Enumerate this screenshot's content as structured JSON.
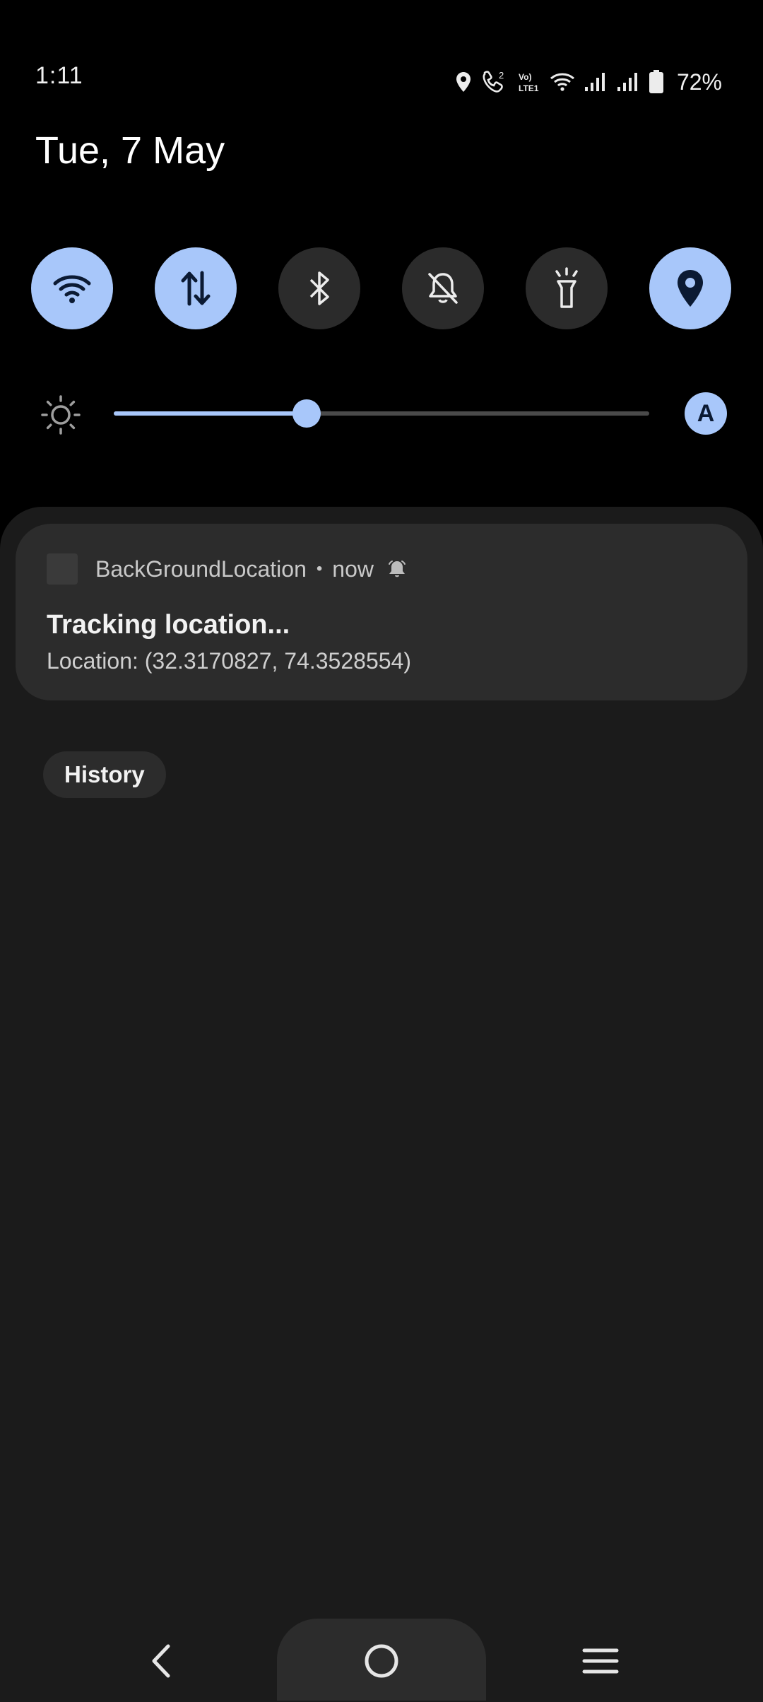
{
  "status_bar": {
    "time": "1:11",
    "battery_percent": "72%",
    "icons": [
      "location-icon",
      "wifi-calling-icon",
      "volte-icon",
      "wifi-icon",
      "signal-sim1-icon",
      "signal-sim2-icon",
      "battery-icon"
    ],
    "volte_label": "Vo) LTE1",
    "call_sim": "2"
  },
  "header": {
    "date": "Tue, 7 May"
  },
  "quick_toggles": [
    {
      "name": "wifi",
      "icon": "wifi-icon",
      "on": true
    },
    {
      "name": "mobile-data",
      "icon": "data-arrows-icon",
      "on": true
    },
    {
      "name": "bluetooth",
      "icon": "bluetooth-icon",
      "on": false
    },
    {
      "name": "sound-mute",
      "icon": "bell-off-icon",
      "on": false
    },
    {
      "name": "flashlight",
      "icon": "flashlight-icon",
      "on": false
    },
    {
      "name": "location",
      "icon": "location-pin-icon",
      "on": true
    }
  ],
  "brightness": {
    "level": 0.36,
    "auto_label": "A"
  },
  "notification": {
    "app_name": "BackGroundLocation",
    "separator": "•",
    "time": "now",
    "title": "Tracking location...",
    "text": "Location: (32.3170827, 74.3528554)"
  },
  "history_label": "History",
  "nav": {
    "back": "back-icon",
    "home": "home-icon",
    "recents": "recents-icon"
  },
  "colors": {
    "accent": "#a8c7fa",
    "panel": "#1b1b1b",
    "card": "#2c2c2c",
    "background": "#000000"
  }
}
